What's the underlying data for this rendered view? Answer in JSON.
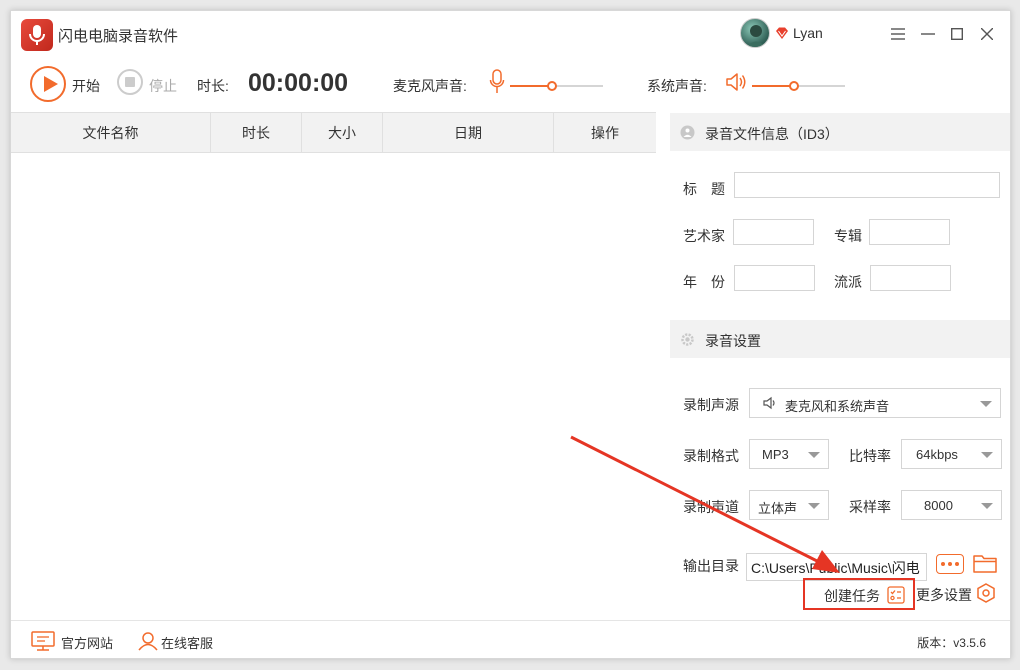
{
  "app": {
    "title": "闪电电脑录音软件",
    "user_name": "Lyan"
  },
  "toolbar": {
    "start_label": "开始",
    "stop_label": "停止",
    "duration_label": "时长:",
    "duration_value": "00:00:00",
    "mic_label": "麦克风声音:",
    "mic_volume": 0.45,
    "system_label": "系统声音:",
    "system_volume": 0.45
  },
  "table": {
    "columns": [
      "文件名称",
      "时长",
      "大小",
      "日期",
      "操作"
    ],
    "rows": []
  },
  "id3": {
    "section_title": "录音文件信息（ID3）",
    "title_label": "标　题",
    "artist_label": "艺术家",
    "album_label": "专辑",
    "year_label": "年　份",
    "genre_label": "流派",
    "title_value": "",
    "artist_value": "",
    "album_value": "",
    "year_value": "",
    "genre_value": ""
  },
  "settings": {
    "section_title": "录音设置",
    "source_label": "录制声源",
    "source_value": "麦克风和系统声音",
    "format_label": "录制格式",
    "format_value": "MP3",
    "bitrate_label": "比特率",
    "bitrate_value": "64kbps",
    "channel_label": "录制声道",
    "channel_value": "立体声",
    "samplerate_label": "采样率",
    "samplerate_value": "8000",
    "output_label": "输出目录",
    "output_value": "C:\\Users\\Public\\Music\\闪电",
    "create_task_label": "创建任务",
    "more_settings_label": "更多设置"
  },
  "footer": {
    "website_label": "官方网站",
    "support_label": "在线客服",
    "version": "版本：v3.5.6"
  },
  "colors": {
    "accent": "#f26b2c",
    "annotation": "#e53524"
  }
}
